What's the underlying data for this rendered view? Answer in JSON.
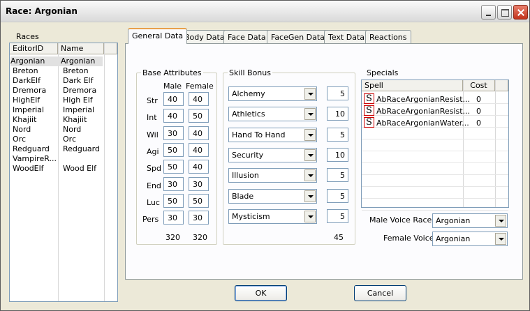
{
  "window": {
    "title": "Race: Argonian"
  },
  "races": {
    "label": "Races",
    "columns": [
      "EditorID",
      "Name"
    ],
    "rows": [
      [
        "Argonian",
        "Argonian"
      ],
      [
        "Breton",
        "Breton"
      ],
      [
        "DarkElf",
        "Dark Elf"
      ],
      [
        "Dremora",
        "Dremora"
      ],
      [
        "HighElf",
        "High Elf"
      ],
      [
        "Imperial",
        "Imperial"
      ],
      [
        "Khajiit",
        "Khajiit"
      ],
      [
        "Nord",
        "Nord"
      ],
      [
        "Orc",
        "Orc"
      ],
      [
        "Redguard",
        "Redguard"
      ],
      [
        "VampireR...",
        ""
      ],
      [
        "WoodElf",
        "Wood Elf"
      ]
    ],
    "selected": "Argonian"
  },
  "tabs": [
    "General Data",
    "Body Data",
    "Face Data",
    "FaceGen Data",
    "Text Data",
    "Reactions"
  ],
  "base_attributes": {
    "title": "Base Attributes",
    "male_header": "Male",
    "female_header": "Female",
    "rows": [
      {
        "label": "Str",
        "male": "40",
        "female": "40"
      },
      {
        "label": "Int",
        "male": "40",
        "female": "50"
      },
      {
        "label": "Wil",
        "male": "30",
        "female": "40"
      },
      {
        "label": "Agi",
        "male": "50",
        "female": "40"
      },
      {
        "label": "Spd",
        "male": "50",
        "female": "40"
      },
      {
        "label": "End",
        "male": "30",
        "female": "30"
      },
      {
        "label": "Luc",
        "male": "50",
        "female": "50"
      },
      {
        "label": "Pers",
        "male": "30",
        "female": "30"
      }
    ],
    "male_total": "320",
    "female_total": "320"
  },
  "skill_bonus": {
    "title": "Skill Bonus",
    "rows": [
      {
        "skill": "Alchemy",
        "value": "5"
      },
      {
        "skill": "Athletics",
        "value": "10"
      },
      {
        "skill": "Hand To Hand",
        "value": "5"
      },
      {
        "skill": "Security",
        "value": "10"
      },
      {
        "skill": "Illusion",
        "value": "5"
      },
      {
        "skill": "Blade",
        "value": "5"
      },
      {
        "skill": "Mysticism",
        "value": "5"
      }
    ],
    "total": "45"
  },
  "specials": {
    "title": "Specials",
    "columns": [
      "Spell",
      "Cost"
    ],
    "icon_glyph": "S",
    "rows": [
      {
        "spell": "AbRaceArgonianResist...",
        "cost": "0"
      },
      {
        "spell": "AbRaceArgonianResist...",
        "cost": "0"
      },
      {
        "spell": "AbRaceArgonianWater...",
        "cost": "0"
      }
    ]
  },
  "voices": {
    "male_label": "Male Voice Race:",
    "male_value": "Argonian",
    "female_label": "Female Voice",
    "female_value": "Argonian"
  },
  "buttons": {
    "ok": "OK",
    "cancel": "Cancel"
  }
}
